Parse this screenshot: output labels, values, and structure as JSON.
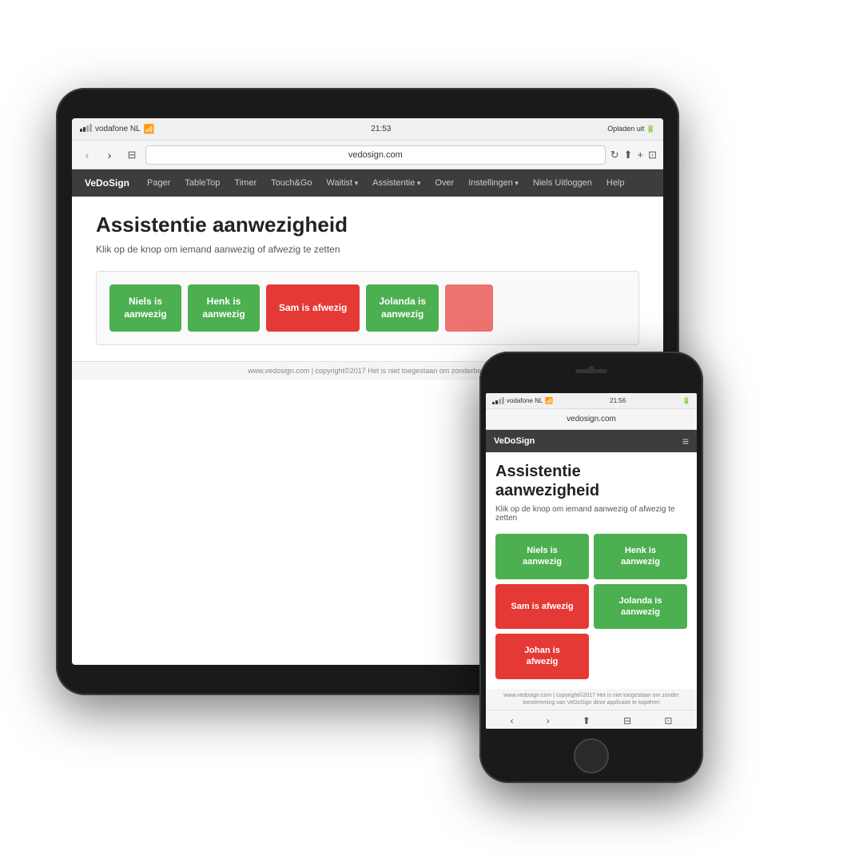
{
  "tablet": {
    "statusbar": {
      "carrier": "vodafone NL",
      "wifi": "wifi",
      "time": "21:53",
      "charge": "Opladen uit"
    },
    "browserbar": {
      "url": "vedosign.com"
    },
    "nav": {
      "brand": "VeDoSign",
      "items": [
        {
          "label": "Pager"
        },
        {
          "label": "TableTop"
        },
        {
          "label": "Timer"
        },
        {
          "label": "Touch&Go"
        },
        {
          "label": "Waitist",
          "dropdown": true
        },
        {
          "label": "Assistentie",
          "dropdown": true
        },
        {
          "label": "Over"
        },
        {
          "label": "Instellingen",
          "dropdown": true
        },
        {
          "label": "Niels Uitloggen"
        },
        {
          "label": "Help"
        }
      ]
    },
    "content": {
      "title": "Assistentie aanwezigheid",
      "subtitle": "Klik op de knop om iemand aanwezig of afwezig te zetten",
      "buttons": [
        {
          "label": "Niels is aanwezig",
          "color": "green"
        },
        {
          "label": "Henk is aanwezig",
          "color": "green"
        },
        {
          "label": "Sam is afwezig",
          "color": "red"
        },
        {
          "label": "Jolanda is aanwezig",
          "color": "green"
        },
        {
          "label": "...",
          "color": "red"
        }
      ]
    },
    "footer": "www.vedosign.com | copyright©2017 Het is niet toegestaan om zonderbe..."
  },
  "phone": {
    "statusbar": {
      "carrier": "vodafone NL",
      "wifi": "wifi",
      "time": "21:56",
      "battery": "battery"
    },
    "browserbar": {
      "url": "vedosign.com"
    },
    "nav": {
      "brand": "VeDoSign",
      "menu_icon": "≡"
    },
    "content": {
      "title": "Assistentie aanwezigheid",
      "subtitle": "Klik op de knop om iemand aanwezig of afwezig te zetten",
      "buttons": [
        {
          "label": "Niels is aanwezig",
          "color": "green"
        },
        {
          "label": "Henk is aanwezig",
          "color": "green"
        },
        {
          "label": "Sam is afwezig",
          "color": "red"
        },
        {
          "label": "Jolanda is aanwezig",
          "color": "green"
        },
        {
          "label": "Johan is afwezig",
          "color": "red"
        }
      ]
    },
    "footer": "www.vedosign.com | copyright©2017 Het is niet toegestaan om zonder toestemming van VeDoSign deze applicatie te kopiëren",
    "bottombar": {
      "back": "‹",
      "forward": "›",
      "share": "⬆",
      "bookmarks": "⊟",
      "tabs": "⊡"
    }
  }
}
